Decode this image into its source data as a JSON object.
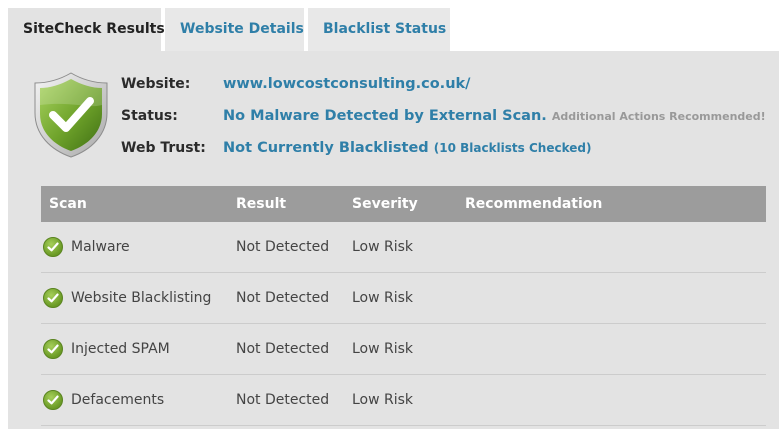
{
  "tabs": [
    {
      "label": "SiteCheck Results",
      "active": true
    },
    {
      "label": "Website Details",
      "active": false
    },
    {
      "label": "Blacklist Status",
      "active": false
    }
  ],
  "summary": {
    "website_label": "Website:",
    "website_value": "www.lowcostconsulting.co.uk/",
    "status_label": "Status:",
    "status_value": "No Malware Detected by External Scan.",
    "status_note": "Additional Actions Recommended!",
    "trust_label": "Web Trust:",
    "trust_value": "Not Currently Blacklisted",
    "trust_note": "(10 Blacklists Checked)"
  },
  "table": {
    "headers": [
      "Scan",
      "Result",
      "Severity",
      "Recommendation"
    ],
    "rows": [
      {
        "scan": "Malware",
        "result": "Not Detected",
        "severity": "Low Risk",
        "recommendation": ""
      },
      {
        "scan": "Website Blacklisting",
        "result": "Not Detected",
        "severity": "Low Risk",
        "recommendation": ""
      },
      {
        "scan": "Injected SPAM",
        "result": "Not Detected",
        "severity": "Low Risk",
        "recommendation": ""
      },
      {
        "scan": "Defacements",
        "result": "Not Detected",
        "severity": "Low Risk",
        "recommendation": ""
      }
    ]
  },
  "icons": {
    "shield": "shield-check-icon",
    "row_status": "check-circle-icon"
  },
  "colors": {
    "link_blue": "#2f7fa8",
    "header_gray": "#9c9c9c",
    "panel_gray": "#e3e3e3",
    "success_green": "#6a9a25"
  }
}
